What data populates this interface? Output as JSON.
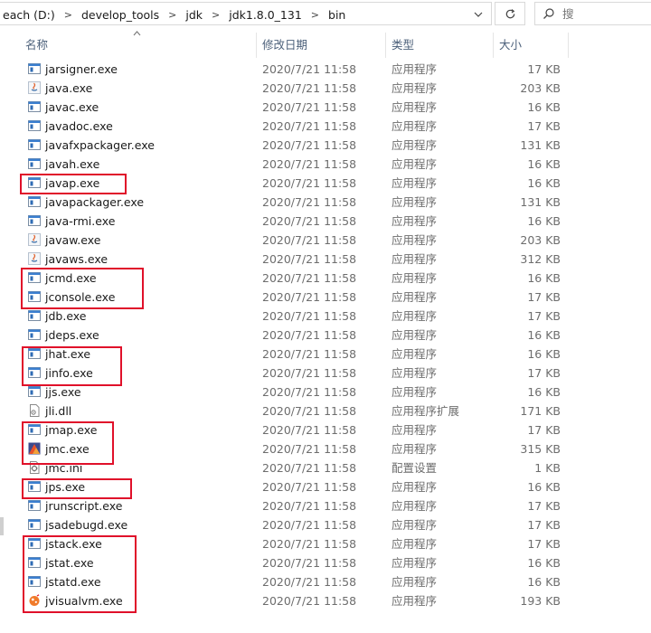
{
  "address_bar": {
    "crumbs": [
      "each (D:)",
      "develop_tools",
      "jdk",
      "jdk1.8.0_131",
      "bin"
    ],
    "search_placeholder": "搜"
  },
  "columns": {
    "name": "名称",
    "date": "修改日期",
    "type": "类型",
    "size": "大小"
  },
  "files": [
    {
      "name": "jarsigner.exe",
      "date": "2020/7/21 11:58",
      "type": "应用程序",
      "size": "17 KB",
      "icon": "exe-icon"
    },
    {
      "name": "java.exe",
      "date": "2020/7/21 11:58",
      "type": "应用程序",
      "size": "203 KB",
      "icon": "java-icon"
    },
    {
      "name": "javac.exe",
      "date": "2020/7/21 11:58",
      "type": "应用程序",
      "size": "16 KB",
      "icon": "exe-icon"
    },
    {
      "name": "javadoc.exe",
      "date": "2020/7/21 11:58",
      "type": "应用程序",
      "size": "17 KB",
      "icon": "exe-icon"
    },
    {
      "name": "javafxpackager.exe",
      "date": "2020/7/21 11:58",
      "type": "应用程序",
      "size": "131 KB",
      "icon": "exe-icon"
    },
    {
      "name": "javah.exe",
      "date": "2020/7/21 11:58",
      "type": "应用程序",
      "size": "16 KB",
      "icon": "exe-icon"
    },
    {
      "name": "javap.exe",
      "date": "2020/7/21 11:58",
      "type": "应用程序",
      "size": "16 KB",
      "icon": "exe-icon"
    },
    {
      "name": "javapackager.exe",
      "date": "2020/7/21 11:58",
      "type": "应用程序",
      "size": "131 KB",
      "icon": "exe-icon"
    },
    {
      "name": "java-rmi.exe",
      "date": "2020/7/21 11:58",
      "type": "应用程序",
      "size": "16 KB",
      "icon": "exe-icon"
    },
    {
      "name": "javaw.exe",
      "date": "2020/7/21 11:58",
      "type": "应用程序",
      "size": "203 KB",
      "icon": "java-icon"
    },
    {
      "name": "javaws.exe",
      "date": "2020/7/21 11:58",
      "type": "应用程序",
      "size": "312 KB",
      "icon": "java-icon"
    },
    {
      "name": "jcmd.exe",
      "date": "2020/7/21 11:58",
      "type": "应用程序",
      "size": "16 KB",
      "icon": "exe-icon"
    },
    {
      "name": "jconsole.exe",
      "date": "2020/7/21 11:58",
      "type": "应用程序",
      "size": "17 KB",
      "icon": "exe-icon"
    },
    {
      "name": "jdb.exe",
      "date": "2020/7/21 11:58",
      "type": "应用程序",
      "size": "17 KB",
      "icon": "exe-icon"
    },
    {
      "name": "jdeps.exe",
      "date": "2020/7/21 11:58",
      "type": "应用程序",
      "size": "16 KB",
      "icon": "exe-icon"
    },
    {
      "name": "jhat.exe",
      "date": "2020/7/21 11:58",
      "type": "应用程序",
      "size": "16 KB",
      "icon": "exe-icon"
    },
    {
      "name": "jinfo.exe",
      "date": "2020/7/21 11:58",
      "type": "应用程序",
      "size": "17 KB",
      "icon": "exe-icon"
    },
    {
      "name": "jjs.exe",
      "date": "2020/7/21 11:58",
      "type": "应用程序",
      "size": "16 KB",
      "icon": "exe-icon"
    },
    {
      "name": "jli.dll",
      "date": "2020/7/21 11:58",
      "type": "应用程序扩展",
      "size": "171 KB",
      "icon": "dll-icon"
    },
    {
      "name": "jmap.exe",
      "date": "2020/7/21 11:58",
      "type": "应用程序",
      "size": "17 KB",
      "icon": "exe-icon"
    },
    {
      "name": "jmc.exe",
      "date": "2020/7/21 11:58",
      "type": "应用程序",
      "size": "315 KB",
      "icon": "jmc-icon"
    },
    {
      "name": "jmc.ini",
      "date": "2020/7/21 11:58",
      "type": "配置设置",
      "size": "1 KB",
      "icon": "ini-icon"
    },
    {
      "name": "jps.exe",
      "date": "2020/7/21 11:58",
      "type": "应用程序",
      "size": "16 KB",
      "icon": "exe-icon"
    },
    {
      "name": "jrunscript.exe",
      "date": "2020/7/21 11:58",
      "type": "应用程序",
      "size": "17 KB",
      "icon": "exe-icon"
    },
    {
      "name": "jsadebugd.exe",
      "date": "2020/7/21 11:58",
      "type": "应用程序",
      "size": "17 KB",
      "icon": "exe-icon"
    },
    {
      "name": "jstack.exe",
      "date": "2020/7/21 11:58",
      "type": "应用程序",
      "size": "17 KB",
      "icon": "exe-icon"
    },
    {
      "name": "jstat.exe",
      "date": "2020/7/21 11:58",
      "type": "应用程序",
      "size": "16 KB",
      "icon": "exe-icon"
    },
    {
      "name": "jstatd.exe",
      "date": "2020/7/21 11:58",
      "type": "应用程序",
      "size": "16 KB",
      "icon": "exe-icon"
    },
    {
      "name": "jvisualvm.exe",
      "date": "2020/7/21 11:58",
      "type": "应用程序",
      "size": "193 KB",
      "icon": "visualvm-icon"
    }
  ],
  "colors": {
    "highlight": "#e0102a",
    "header_text": "#4c607a",
    "secondary_text": "#6d6d6d"
  }
}
